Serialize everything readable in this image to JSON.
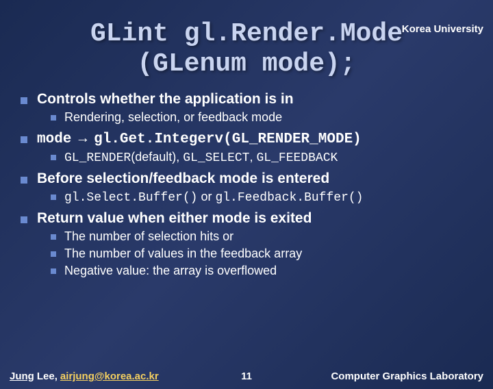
{
  "header": {
    "org": "Korea University"
  },
  "title": {
    "line1": "GLint gl.Render.Mode",
    "line2": "(GLenum mode);"
  },
  "bullets": {
    "b1": "Controls whether the application is in",
    "b1a": "Rendering, selection, or feedback mode",
    "b2_pre": "mode",
    "b2_arrow": "→",
    "b2_code": "gl.Get.Integerv(GL_RENDER_MODE)",
    "b2a_pre": "GL_RENDER",
    "b2a_mid": "(default), ",
    "b2a_c2": "GL_SELECT",
    "b2a_sep": ", ",
    "b2a_c3": "GL_FEEDBACK",
    "b3": "Before selection/feedback mode is entered",
    "b3a_c1": "gl.Select.Buffer()",
    "b3a_or": " or ",
    "b3a_c2": "gl.Feedback.Buffer()",
    "b4": "Return value when either mode is exited",
    "b4a": "The number of selection hits or",
    "b4b": "The number of values in the feedback array",
    "b4c": "Negative value: the array is overflowed"
  },
  "footer": {
    "author_first": "Jung",
    "author_last": "Lee,",
    "email": "airjung@korea.ac.kr",
    "page": "11",
    "lab": "Computer Graphics Laboratory"
  }
}
